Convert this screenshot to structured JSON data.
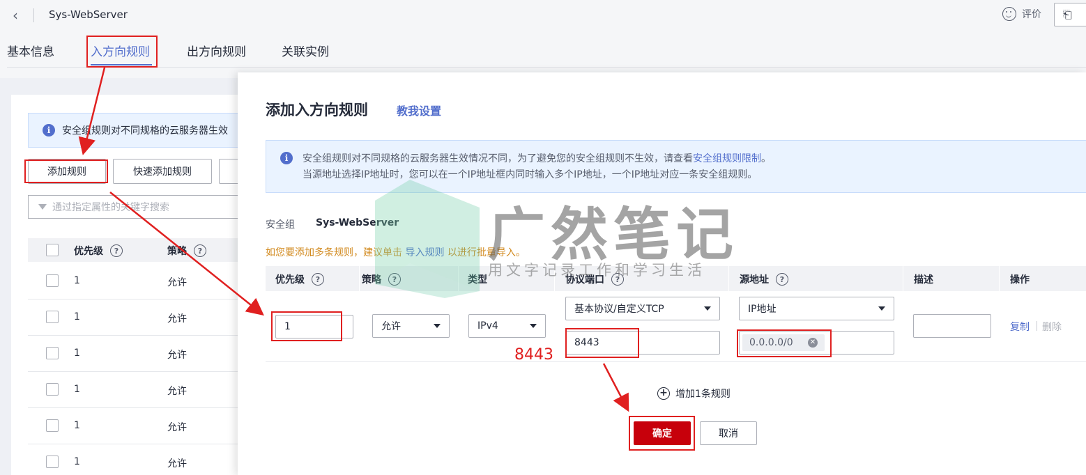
{
  "header": {
    "title": "Sys-WebServer",
    "rate_label": "评价"
  },
  "tabs": [
    {
      "label": "基本信息"
    },
    {
      "label": "入方向规则"
    },
    {
      "label": "出方向规则"
    },
    {
      "label": "关联实例"
    }
  ],
  "background": {
    "notice": "安全组规则对不同规格的云服务器生效",
    "add_rule_button": "添加规则",
    "quick_add_button": "快速添加规则",
    "search_placeholder": "通过指定属性的关键字搜索",
    "headers": {
      "priority": "优先级",
      "policy": "策略"
    },
    "rows": [
      {
        "priority": "1",
        "policy": "允许"
      },
      {
        "priority": "1",
        "policy": "允许"
      },
      {
        "priority": "1",
        "policy": "允许"
      },
      {
        "priority": "1",
        "policy": "允许"
      },
      {
        "priority": "1",
        "policy": "允许"
      },
      {
        "priority": "1",
        "policy": "允许"
      }
    ]
  },
  "modal": {
    "title": "添加入方向规则",
    "help_link": "教我设置",
    "notice_line1_prefix": "安全组规则对不同规格的云服务器生效情况不同，为了避免您的安全组规则不生效，请查看",
    "notice_line1_link": "安全组规则限制",
    "notice_line1_suffix": "。",
    "notice_line2": "当源地址选择IP地址时，您可以在一个IP地址框内同时输入多个IP地址，一个IP地址对应一条安全组规则。",
    "security_group_label": "安全组",
    "security_group_value": "Sys-WebServer",
    "batch_note_prefix": "如您要添加多条规则，建议单击",
    "batch_note_link": "导入规则",
    "batch_note_suffix": "以进行批量导入。",
    "columns": {
      "priority": "优先级",
      "policy": "策略",
      "type": "类型",
      "protocol_port": "协议端口",
      "source": "源地址",
      "description": "描述",
      "action": "操作"
    },
    "rule": {
      "priority": "1",
      "policy": "允许",
      "type": "IPv4",
      "protocol": "基本协议/自定义TCP",
      "port": "8443",
      "source_type": "IP地址",
      "source_ip": "0.0.0.0/0",
      "description": ""
    },
    "copy_link": "复制",
    "delete_link": "删除",
    "add_one_rule": "增加1条规则",
    "ok_button": "确定",
    "cancel_button": "取消"
  },
  "annotation": {
    "port_label": "8443",
    "color": "#e02020"
  },
  "watermark": {
    "title": "广然笔记",
    "subtitle": "用文字记录工作和学习生活"
  },
  "colors": {
    "accent": "#526ecc",
    "primary_button": "#c7000b",
    "notice_bg": "#eaf3ff",
    "warning_text": "#d28a1f"
  }
}
